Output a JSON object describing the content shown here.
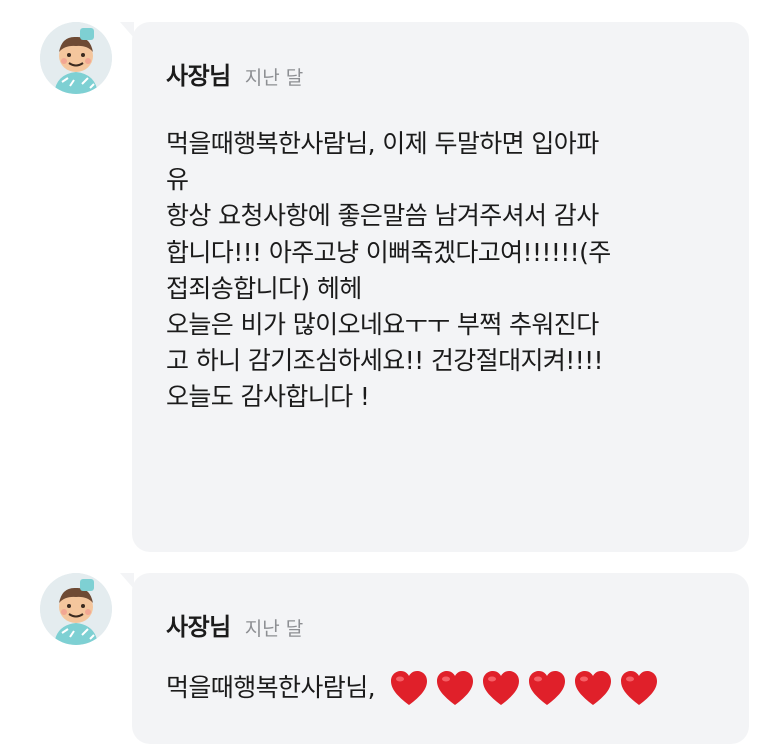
{
  "comments": [
    {
      "author": "사장님",
      "time": "지난 달",
      "avatar_icon": "chef-character-avatar-icon",
      "lines": [
        "먹을때행복한사람님, 이제 두말하면 입아파",
        "유",
        "항상 요청사항에 좋은말씀 남겨주셔서 감사",
        "합니다!!! 아주고냥 이뻐죽겠다고여!!!!!!(주",
        "접죄송합니다) 헤헤",
        "오늘은 비가 많이오네요ㅜㅜ 부쩍 추워진다",
        "고 하니 감기조심하세요!! 건강절대지켜!!!!",
        "오늘도 감사합니다 !"
      ]
    },
    {
      "author": "사장님",
      "time": "지난 달",
      "avatar_icon": "chef-character-avatar-icon",
      "text": "먹을때행복한사람님,",
      "hearts": [
        "red-heart-icon",
        "red-heart-icon",
        "red-heart-icon",
        "red-heart-icon",
        "red-heart-icon",
        "red-heart-icon"
      ]
    }
  ],
  "colors": {
    "bubble": "#f3f4f6",
    "text": "#1b1b1b",
    "time": "#8d8f93",
    "heart": "#e0202a"
  }
}
